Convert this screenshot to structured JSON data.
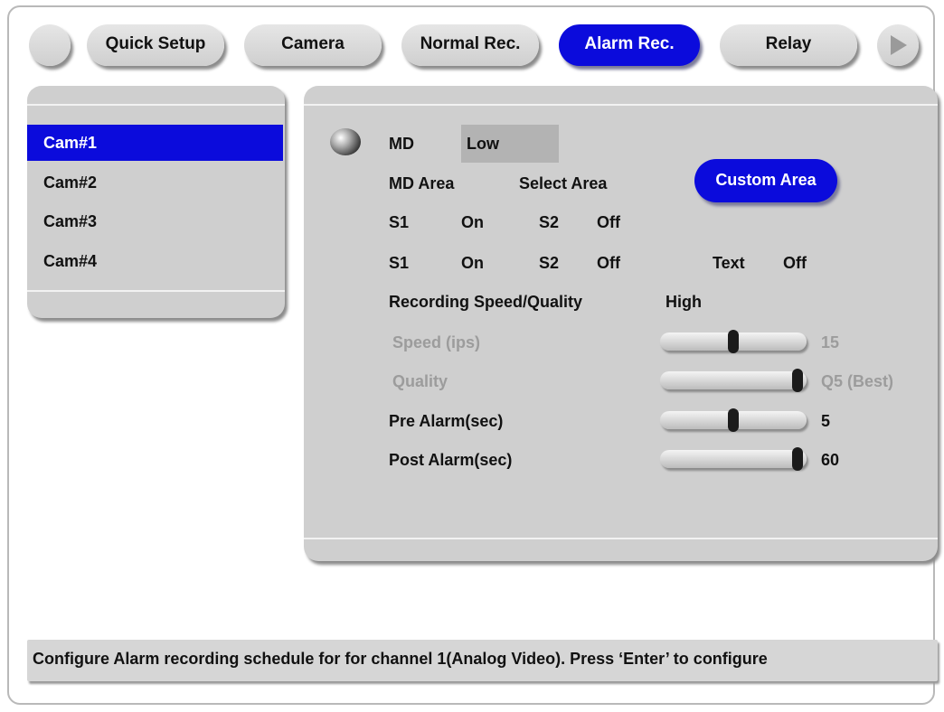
{
  "tabs": {
    "quick_setup": "Quick Setup",
    "camera": "Camera",
    "normal_rec": "Normal Rec.",
    "alarm_rec": "Alarm Rec.",
    "relay": "Relay",
    "active": "Alarm Rec."
  },
  "cameras": [
    "Cam#1",
    "Cam#2",
    "Cam#3",
    "Cam#4"
  ],
  "selected_camera": "Cam#1",
  "settings": {
    "md_label": "MD",
    "md_value": "Low",
    "md_area_label": "MD Area",
    "md_area_value": "Select Area",
    "custom_area_button": "Custom Area",
    "row1": {
      "s1": "S1",
      "s1_val": "On",
      "s2": "S2",
      "s2_val": "Off"
    },
    "row2": {
      "s1": "S1",
      "s1_val": "On",
      "s2": "S2",
      "s2_val": "Off",
      "text": "Text",
      "text_val": "Off"
    },
    "rsq_label": "Recording Speed/Quality",
    "rsq_value": "High",
    "speed_label": "Speed (ips)",
    "speed_value": "15",
    "speed_level": 0.5,
    "quality_label": "Quality",
    "quality_value": "Q5 (Best)",
    "quality_level": 1.0,
    "pre_alarm_label": "Pre Alarm(sec)",
    "pre_alarm_value": "5",
    "pre_alarm_level": 0.5,
    "post_alarm_label": "Post Alarm(sec)",
    "post_alarm_value": "60",
    "post_alarm_level": 1.0
  },
  "status_text": "Configure Alarm recording schedule for for channel 1(Analog Video). Press ‘Enter’ to configure",
  "colors": {
    "accent": "#0b0bdc",
    "panel": "#cfcfcf",
    "dim_text": "#9c9c9c"
  },
  "icons": {
    "nav_left": "circle-button",
    "nav_right": "play-arrow-icon",
    "md_indicator": "knob-icon"
  }
}
